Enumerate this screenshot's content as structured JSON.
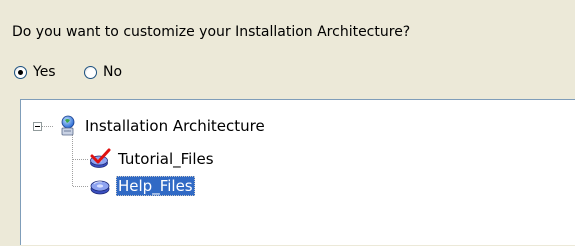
{
  "question": "Do you want to customize your Installation Architecture?",
  "radios": [
    {
      "label": "Yes",
      "checked": true
    },
    {
      "label": "No",
      "checked": false
    }
  ],
  "tree": {
    "root": {
      "label": "Installation Architecture",
      "icon": "server-globe-icon",
      "expanded": true
    },
    "children": [
      {
        "label": "Tutorial_Files",
        "icon": "feature-check-icon",
        "selected": false
      },
      {
        "label": "Help_Files",
        "icon": "feature-disk-icon",
        "selected": true
      }
    ]
  },
  "colors": {
    "window_bg": "#ece9d8",
    "selection_bg": "#316ac5",
    "tree_border": "#7f9db9"
  }
}
